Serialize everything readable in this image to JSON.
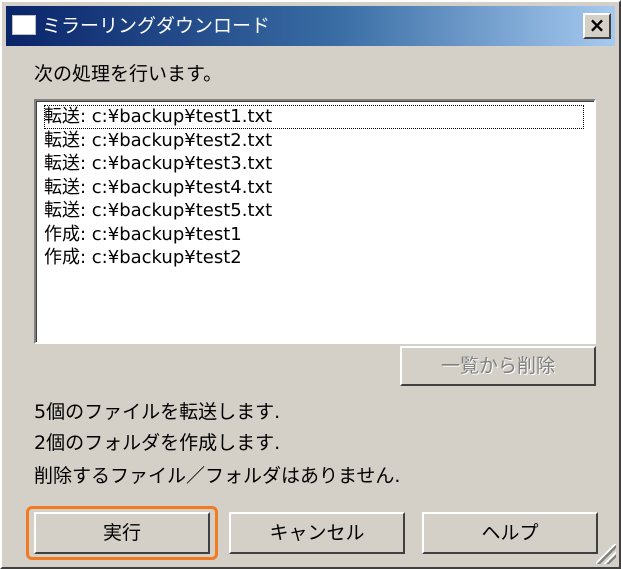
{
  "window": {
    "title": "ミラーリングダウンロード",
    "close_label": "×"
  },
  "dialog": {
    "prompt": "次の処理を行います。",
    "list_items": [
      "転送: c:¥backup¥test1.txt",
      "転送: c:¥backup¥test2.txt",
      "転送: c:¥backup¥test3.txt",
      "転送: c:¥backup¥test4.txt",
      "転送: c:¥backup¥test5.txt",
      "作成: c:¥backup¥test1",
      "作成: c:¥backup¥test2"
    ],
    "remove_button_label": "一覧から削除",
    "summary_lines": [
      "5個のファイルを転送します.",
      "2個のフォルダを作成します.",
      "削除するファイル／フォルダはありません."
    ]
  },
  "buttons": {
    "execute_label": "実行",
    "cancel_label": "キャンセル",
    "help_label": "ヘルプ"
  },
  "colors": {
    "highlight": "#f27a20",
    "titlebar_start": "#0a246a",
    "titlebar_end": "#a6caf0"
  }
}
